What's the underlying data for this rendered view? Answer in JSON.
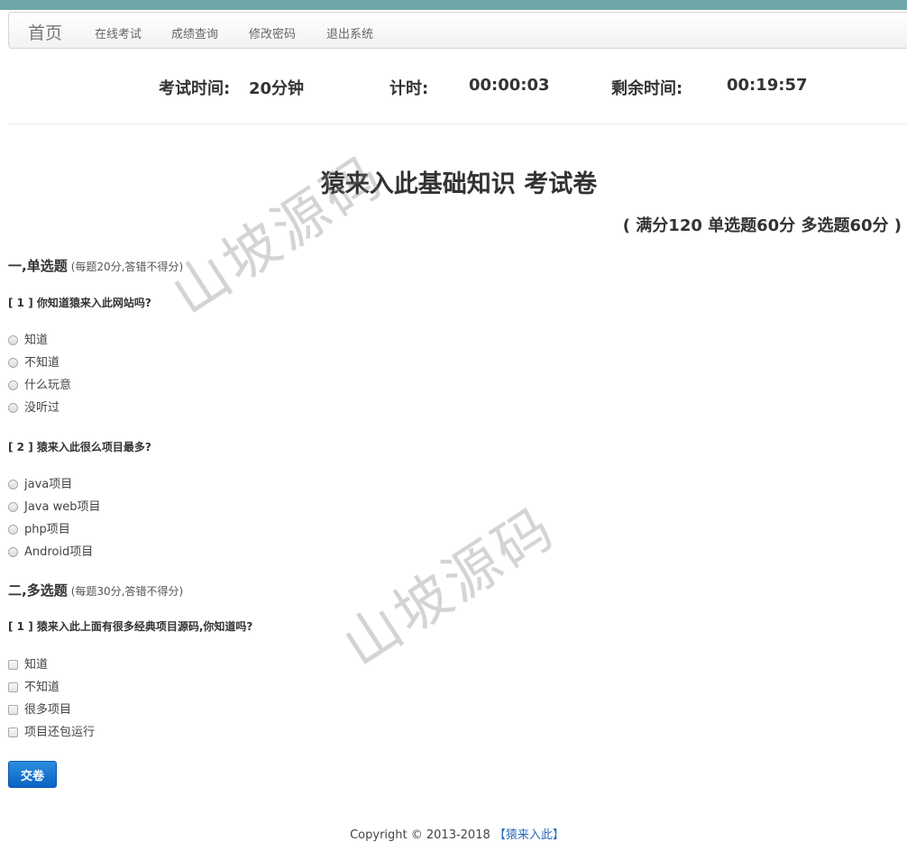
{
  "nav": {
    "brand": "首页",
    "items": [
      "在线考试",
      "成绩查询",
      "修改密码",
      "退出系统"
    ]
  },
  "timer": {
    "exam_time_label": "考试时间:",
    "exam_time_value": "20分钟",
    "elapsed_label": "计时:",
    "elapsed_value": "00:00:03",
    "remaining_label": "剩余时间:",
    "remaining_value": "00:19:57"
  },
  "exam": {
    "title": "猿来入此基础知识 考试卷",
    "score_note": "( 满分120 单选题60分 多选题60分 )"
  },
  "sections": {
    "single": {
      "title": "一,单选题",
      "note": "(每题20分,答错不得分)",
      "questions": [
        {
          "text": "[ 1 ] 你知道猿来入此网站吗?",
          "options": [
            "知道",
            "不知道",
            "什么玩意",
            "没听过"
          ]
        },
        {
          "text": "[ 2 ] 猿来入此很么项目最多?",
          "options": [
            "java项目",
            "Java web项目",
            "php项目",
            "Android项目"
          ]
        }
      ]
    },
    "multi": {
      "title": "二,多选题",
      "note": "(每题30分,答错不得分)",
      "questions": [
        {
          "text": "[ 1 ] 猿来入此上面有很多经典项目源码,你知道吗?",
          "options": [
            "知道",
            "不知道",
            "很多项目",
            "项目还包运行"
          ]
        }
      ]
    }
  },
  "submit_label": "交卷",
  "footer": {
    "copyright": "Copyright © 2013-2018",
    "link": "【猿来入此】"
  },
  "watermark": "山坡源码",
  "colors": {
    "topbar": "#6fa6a8",
    "button": "#0b62c4",
    "link": "#2a6ebb"
  }
}
